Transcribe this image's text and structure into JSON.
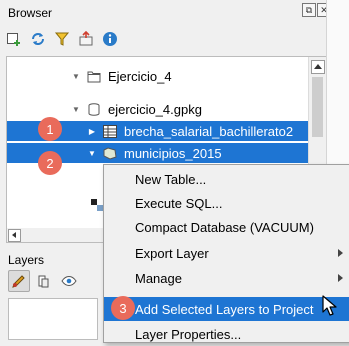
{
  "browser": {
    "title": "Browser",
    "panel_buttons": {
      "float": "⧉",
      "close": "✕"
    },
    "toolbar_icons": [
      "add-layer-icon",
      "refresh-icon",
      "filter-icon",
      "collapse-icon",
      "info-icon"
    ],
    "tree": [
      {
        "label": "Ejercicio_4",
        "icon": "folder-icon",
        "expanded": true,
        "selected": false
      },
      {
        "label": "ejercicio_4.gpkg",
        "icon": "database-icon",
        "expanded": true,
        "selected": false
      },
      {
        "label": "brecha_salarial_bachillerato2",
        "icon": "table-icon",
        "expanded": false,
        "selected": true
      },
      {
        "label": "municipios_2015",
        "icon": "polygon-layer-icon",
        "expanded": true,
        "selected": true
      }
    ]
  },
  "layers": {
    "title": "Layers",
    "toolbar_icons": [
      "style-icon",
      "add-group-icon",
      "visibility-icon"
    ]
  },
  "context_menu": {
    "items": [
      {
        "label": "New Table...",
        "submenu": false,
        "highlighted": false
      },
      {
        "label": "Execute SQL...",
        "submenu": false,
        "highlighted": false
      },
      {
        "label": "Compact Database (VACUUM)",
        "submenu": false,
        "highlighted": false
      },
      {
        "label": "Export Layer",
        "submenu": true,
        "highlighted": false
      },
      {
        "label": "Manage",
        "submenu": true,
        "highlighted": false
      },
      {
        "label": "Add Selected Layers to Project",
        "submenu": false,
        "highlighted": true
      },
      {
        "label": "Layer Properties...",
        "submenu": false,
        "highlighted": false
      }
    ]
  },
  "annotations": [
    "1",
    "2",
    "3"
  ],
  "colors": {
    "selection": "#1e75d3",
    "badge": "#e96b5b",
    "menu_bg": "#f0f0f0"
  }
}
